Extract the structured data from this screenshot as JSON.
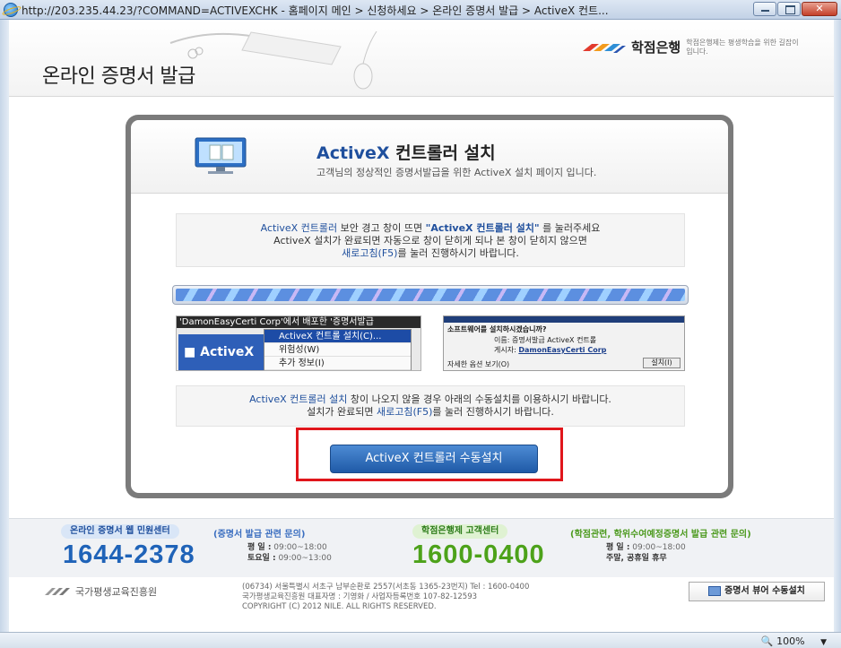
{
  "window": {
    "title": "http://203.235.44.23/?COMMAND=ACTIVEXCHK - 홈페이지 메인 > 신청하세요 > 온라인 증명서 발급 > ActiveX 컨트..."
  },
  "header": {
    "page_title": "온라인 증명서 발급",
    "logo_name": "학점은행",
    "logo_tagline": "학점은행제는 평생학습을 위한 길잡이 입니다."
  },
  "card": {
    "title_prefix": "ActiveX",
    "title_suffix": " 컨트롤러 설치",
    "subtitle": "고객님의 정상적인 증명서발급을 위한 ActiveX 설치 페이지 입니다.",
    "notice1": {
      "line1_a": "ActiveX 컨트롤러",
      "line1_b": " 보안 경고 창이 뜨면 ",
      "line1_c": "\"ActiveX 컨트롤러 설치\"",
      "line1_d": " 를 눌러주세요",
      "line2": "ActiveX 설치가 완료되면 자동으로 창이 닫히게 되나 본 창이 닫히지 않으면",
      "line3_a": "새로고침(F5)",
      "line3_b": "를 눌러 진행하시기 바랍니다."
    },
    "screenshot_left": {
      "title": "'DamonEasyCerti Corp'에서 배포한 '증명서발급",
      "activex_label": "ActiveX",
      "menu": [
        "ActiveX 컨트롤 설치(C)...",
        "위험성(W)",
        "추가 정보(I)"
      ]
    },
    "screenshot_right": {
      "question": "소프트웨어를 설치하시겠습니까?",
      "name_line": "이름: 증명서발급 ActiveX 컨트롤",
      "publisher_label": "게시자: ",
      "publisher": "DamonEasyCerti Corp",
      "options": "자세한 옵션 보기(O)",
      "install": "설치(I)"
    },
    "notice2": {
      "line1_a": "ActiveX 컨트롤러 설치",
      "line1_b": " 창이 나오지 않을 경우 아래의 수동설치를 이용하시기 바랍니다.",
      "line2_a": "설치가 완료되면 ",
      "line2_b": "새로고침(F5)",
      "line2_c": "를 눌러 진행하시기 바랍니다."
    },
    "install_button": "ActiveX 컨트롤러 수동설치"
  },
  "help": {
    "left": {
      "pill": "온라인 증명서 웹 민원센터",
      "note": "(증명서 발급 관련 문의)",
      "phone": "1644-2378",
      "hours1_label": "평  일 :",
      "hours1": " 09:00~18:00",
      "hours2_label": "토요일 :",
      "hours2": " 09:00~13:00"
    },
    "right": {
      "pill": "학점은행제 고객센터",
      "note": "(학점관련, 학위수여예정증명서 발급 관련 문의)",
      "phone": "1600-0400",
      "hours1_label": "평  일 :",
      "hours1": " 09:00~18:00",
      "hours2_label": "주말, 공휴일 휴무",
      "hours2": ""
    }
  },
  "footer": {
    "org_name": "국가평생교육진흥원",
    "address": "(06734) 서울특별시 서초구 남부순환로 2557(서초동 1365-23번지)   Tel : 1600-0400",
    "ceo": "국가평생교육진흥원 대표자명 : 기영화 / 사업자등록번호 107-82-12593",
    "copyright": "COPYRIGHT (C) 2012 NILE. ALL RIGHTS RESERVED.",
    "viewer_button": "증명서 뷰어 수동설치"
  },
  "status": {
    "zoom": "100%"
  },
  "colors": {
    "accent_blue": "#1f4f9d",
    "accent_green": "#4da21a",
    "highlight_red": "#e0161b"
  }
}
